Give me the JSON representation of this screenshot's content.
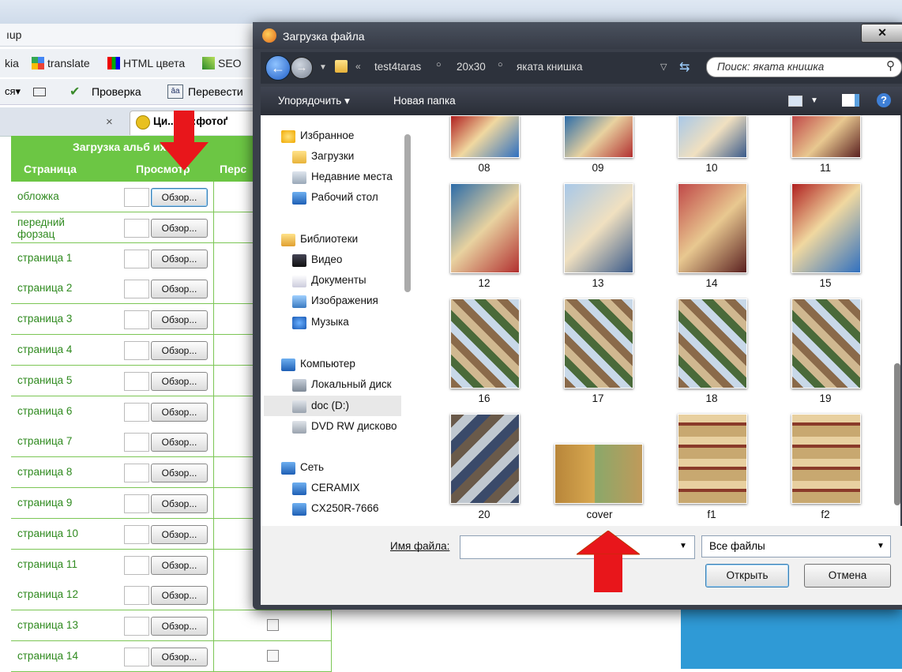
{
  "browser": {
    "title_fragment": "ıup",
    "bookmarks": [
      "kia",
      "translate",
      "HTML цвета",
      "SEO"
    ],
    "toolbar2": {
      "left": "ся▾",
      "check_label": "Проверка",
      "translate_label": "Перевести"
    },
    "tab_close": "×",
    "tab_title": "Ци...аб::фотоґ"
  },
  "table": {
    "title": "Загрузка альб    их стран",
    "headers": [
      "Страница",
      "Просмотр",
      "Перс"
    ],
    "browse_label": "Обзор...",
    "rows": [
      "обложка",
      "передний форзац",
      "страница 1",
      "страница 2",
      "страница 3",
      "страница 4",
      "страница 5",
      "страница 6",
      "страница 7",
      "страница 8",
      "страница 9",
      "страница 10",
      "страница 11",
      "страница 12",
      "страница 13",
      "страница 14"
    ]
  },
  "dialog": {
    "title": "Загрузка файла",
    "close_label": "✕",
    "breadcrumb": [
      "test4taras",
      "20x30",
      "яката книшка"
    ],
    "search_placeholder": "Поиск: яката книшка",
    "organize_label": "Упорядочить ▾",
    "new_folder_label": "Новая папка",
    "nav": {
      "favorites": "Избранное",
      "downloads": "Загрузки",
      "recent": "Недавние места",
      "desktop": "Рабочий стол",
      "libraries": "Библиотеки",
      "video": "Видео",
      "documents": "Документы",
      "images": "Изображения",
      "music": "Музыка",
      "computer": "Компьютер",
      "local_disk": "Локальный диск",
      "doc_d": "doc (D:)",
      "dvd": "DVD RW дисково",
      "network": "Сеть",
      "ceramix": "CERAMIX",
      "cx250": "CX250R-7666"
    },
    "files": [
      "08",
      "09",
      "10",
      "11",
      "12",
      "13",
      "14",
      "15",
      "16",
      "17",
      "18",
      "19",
      "20",
      "cover",
      "f1",
      "f2"
    ],
    "filename_label": "Имя файла:",
    "filename_value": "",
    "filetype_value": "Все файлы",
    "open_label": "Открыть",
    "cancel_label": "Отмена"
  },
  "colors": {
    "green_header": "#6cc644",
    "green_text": "#2f8a1f",
    "arrow_red": "#e8161b",
    "dialog_dark": "#3a3f4a"
  }
}
